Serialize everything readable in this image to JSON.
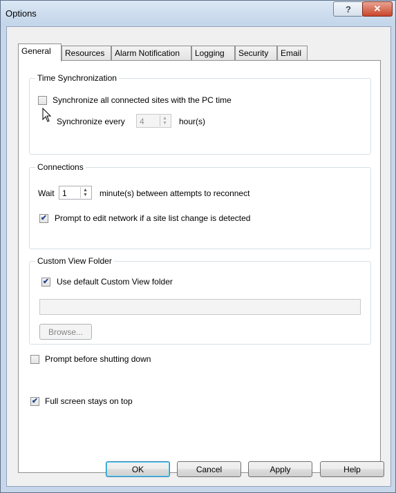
{
  "window": {
    "title": "Options",
    "help_glyph": "?",
    "close_glyph": "✕"
  },
  "tabs": [
    "General",
    "Resources",
    "Alarm Notification",
    "Logging",
    "Security",
    "Email"
  ],
  "time_sync": {
    "legend": "Time Synchronization",
    "sync_all_label": "Synchronize all connected sites with the PC time",
    "sync_all_checked": false,
    "sync_every_label": "Synchronize every",
    "sync_every_value": "4",
    "sync_every_unit": "hour(s)"
  },
  "connections": {
    "legend": "Connections",
    "wait_label": "Wait",
    "wait_value": "1",
    "wait_unit": "minute(s) between attempts to reconnect",
    "prompt_edit_label": "Prompt to edit network if a site list change is detected",
    "prompt_edit_checked": true
  },
  "custom_view": {
    "legend": "Custom View Folder",
    "use_default_label": "Use default Custom View folder",
    "use_default_checked": true,
    "folder_path": "",
    "browse_label": "Browse..."
  },
  "prompt_shutdown": {
    "label": "Prompt before shutting down",
    "checked": false
  },
  "full_screen": {
    "label": "Full screen stays on top",
    "checked": true
  },
  "buttons": {
    "ok": "OK",
    "cancel": "Cancel",
    "apply": "Apply",
    "help": "Help"
  },
  "check_glyph": "✔"
}
